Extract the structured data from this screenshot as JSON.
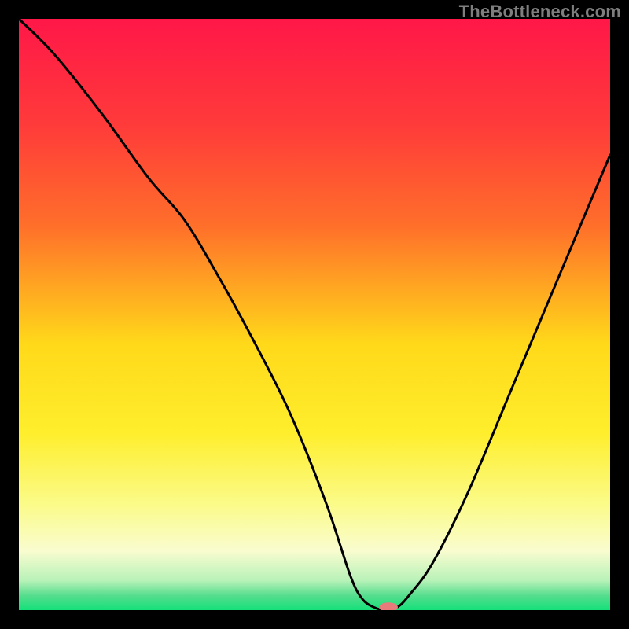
{
  "watermark": "TheBottleneck.com",
  "chart_data": {
    "type": "line",
    "title": "",
    "xlabel": "",
    "ylabel": "",
    "xlim": [
      0,
      100
    ],
    "ylim": [
      0,
      100
    ],
    "grid": false,
    "legend": false,
    "annotations": [],
    "gradient_stops": [
      {
        "offset": 0.0,
        "color": "#ff1748"
      },
      {
        "offset": 0.18,
        "color": "#ff3b3a"
      },
      {
        "offset": 0.35,
        "color": "#ff6f2a"
      },
      {
        "offset": 0.55,
        "color": "#ffd91a"
      },
      {
        "offset": 0.7,
        "color": "#feee2c"
      },
      {
        "offset": 0.82,
        "color": "#fbfb88"
      },
      {
        "offset": 0.9,
        "color": "#f9fccf"
      },
      {
        "offset": 0.95,
        "color": "#b8f2b8"
      },
      {
        "offset": 0.975,
        "color": "#57dd8e"
      },
      {
        "offset": 1.0,
        "color": "#14e07a"
      }
    ],
    "series": [
      {
        "name": "bottleneck-curve",
        "x": [
          0.0,
          6.0,
          14.0,
          22.0,
          28.0,
          34.0,
          40.0,
          46.0,
          52.0,
          56.0,
          58.0,
          60.0,
          62.0,
          64.0,
          66.0,
          70.0,
          76.0,
          84.0,
          92.0,
          100.0
        ],
        "y": [
          100.0,
          94.0,
          84.0,
          73.0,
          66.0,
          56.0,
          45.0,
          33.0,
          18.0,
          6.0,
          2.0,
          0.5,
          0.0,
          0.5,
          2.5,
          8.0,
          20.0,
          39.0,
          58.0,
          77.0
        ]
      }
    ],
    "marker": {
      "x": 62.5,
      "y": 0.5,
      "color": "#e77a7a",
      "rx": 12,
      "ry": 6
    },
    "optimal_x": 62.0
  }
}
